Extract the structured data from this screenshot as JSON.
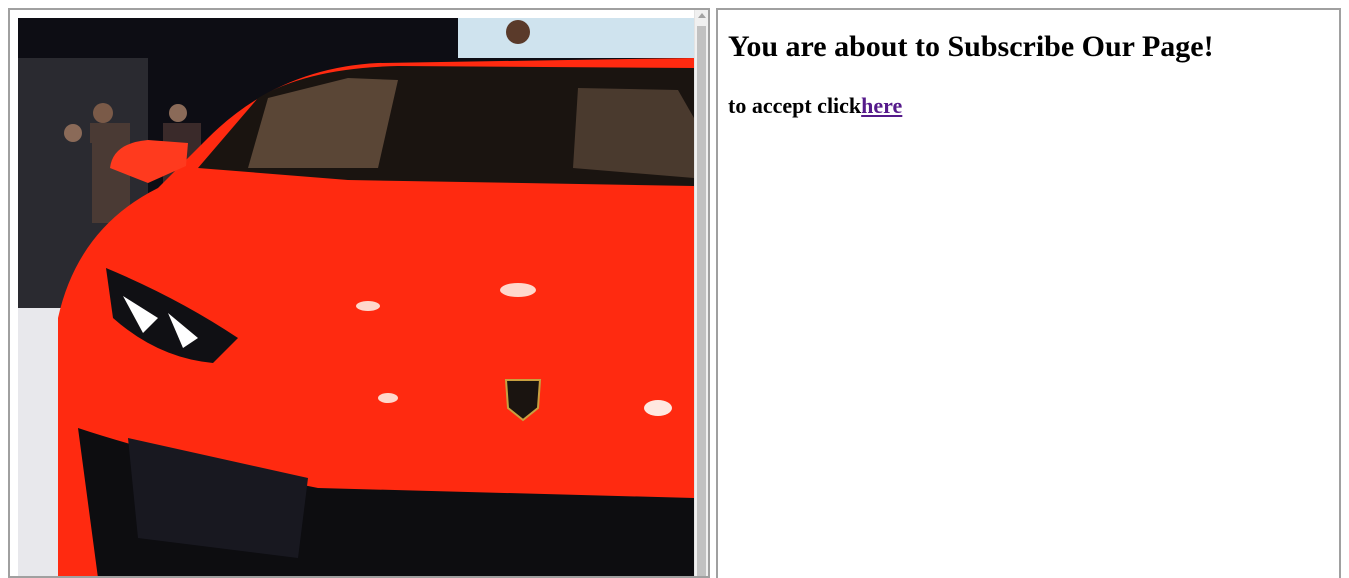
{
  "left_frame": {
    "image_icon": "car-photo-icon"
  },
  "right_frame": {
    "heading": "You are about to Subscribe Our Page!",
    "accept_prefix": "to accept click",
    "link_text": "here",
    "link_color": "#551a8b"
  },
  "colors": {
    "car_red": "#ff2a10",
    "frame_border": "#a0a0a0"
  }
}
